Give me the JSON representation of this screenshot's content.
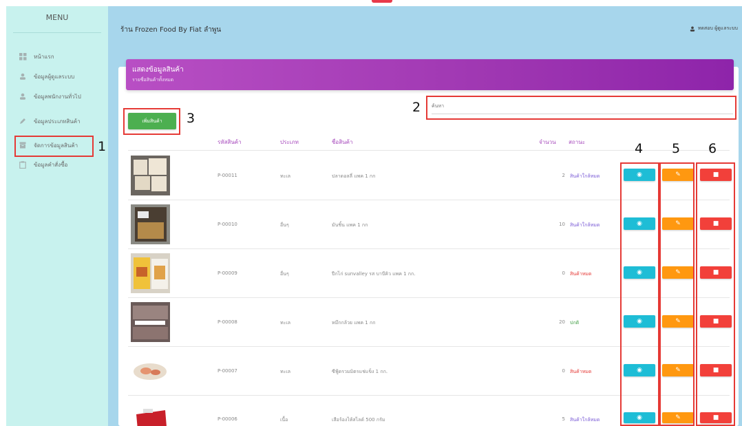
{
  "sidebar": {
    "menu_title": "MENU",
    "items": [
      {
        "label": "หน้าแรก",
        "icon": "dashboard-icon"
      },
      {
        "label": "ข้อมูลผู้ดูแลระบบ",
        "icon": "user-icon"
      },
      {
        "label": "ข้อมูลพนักงานทั่วไป",
        "icon": "user-icon"
      },
      {
        "label": "ข้อมูลประเภทสินค้า",
        "icon": "pencil-icon"
      },
      {
        "label": "จัดการข้อมูลสินค้า",
        "icon": "archive-icon"
      },
      {
        "label": "ข้อมูลคำสั่งซื้อ",
        "icon": "clipboard-icon"
      }
    ]
  },
  "header": {
    "shop_name": "ร้าน Frozen Food By Fiat ลำพูน",
    "user_label": "ทดสอบ ผู้ดูแลระบบ"
  },
  "banner": {
    "title": "แสดงข้อมูลสินค้า",
    "subtitle": "รายชื่อสินค้าทั้งหมด"
  },
  "search": {
    "placeholder": "ค้นหา"
  },
  "add_button": "เพิ่มสินค้า",
  "table": {
    "headers": [
      "รหัสสินค้า",
      "ประเภท",
      "ชื่อสินค้า",
      "จำนวน",
      "สถานะ"
    ],
    "rows": [
      {
        "code": "P-00011",
        "type": "ทะเล",
        "name": "ปลาดอลลี่ แพค 1 กก",
        "qty": "2",
        "status": "สินค้าใกล้หมด",
        "status_color": "#7a5bd6"
      },
      {
        "code": "P-00010",
        "type": "อื่นๆ",
        "name": "มันชิ้น แพค 1 กก",
        "qty": "10",
        "status": "สินค้าใกล้หมด",
        "status_color": "#7a5bd6"
      },
      {
        "code": "P-00009",
        "type": "อื่นๆ",
        "name": "ปีกไก่ sunvalley รส บาบีคิว แพค 1 กก.",
        "qty": "0",
        "status": "สินค้าหมด",
        "status_color": "#e53935"
      },
      {
        "code": "P-00008",
        "type": "ทะเล",
        "name": "หมึกกล้วย แพค 1 กก",
        "qty": "20",
        "status": "ปกติ",
        "status_color": "#43a047"
      },
      {
        "code": "P-00007",
        "type": "ทะเล",
        "name": "ซีฟู้ดรวมมิตรแช่แข็ง 1 กก.",
        "qty": "0",
        "status": "สินค้าหมด",
        "status_color": "#e53935"
      },
      {
        "code": "P-00006",
        "type": "เนื้อ",
        "name": "เสือร้องไห้สไลด์ 500 กรัม",
        "qty": "5",
        "status": "สินค้าใกล้หมด",
        "status_color": "#7a5bd6"
      }
    ]
  },
  "annotations": [
    "1",
    "2",
    "3",
    "4",
    "5",
    "6"
  ],
  "colors": {
    "view": "#1ebdd6",
    "edit": "#ff9810",
    "delete": "#f2403a",
    "banner": "#9f37b2",
    "sidebar": "#c8f2ee",
    "header": "#a7d6ec"
  }
}
